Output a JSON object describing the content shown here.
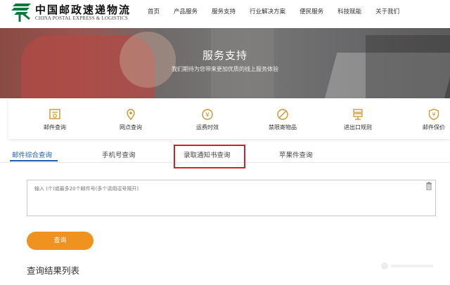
{
  "header": {
    "brand_cn": "中国邮政速递物流",
    "brand_en": "CHINA POSTAL EXPRESS & LOGISTICS",
    "nav": [
      "首页",
      "产品服务",
      "服务支持",
      "行业解决方案",
      "便民服务",
      "科技赋能",
      "关于我们"
    ]
  },
  "banner": {
    "title": "服务支持",
    "subtitle": "我们期待为您带来更加优质的线上服务体验"
  },
  "services": [
    {
      "label": "邮件查询",
      "icon": "mail-search-icon"
    },
    {
      "label": "网点查询",
      "icon": "location-pin-icon"
    },
    {
      "label": "运费时效",
      "icon": "yuan-clock-icon"
    },
    {
      "label": "禁限寄物品",
      "icon": "prohibited-icon"
    },
    {
      "label": "进出口规则",
      "icon": "customs-rules-icon"
    },
    {
      "label": "邮件保价",
      "icon": "shield-yuan-icon"
    }
  ],
  "tabs": [
    "邮件综合查询",
    "手机号查询",
    "录取通知书查询",
    "苹果件查询"
  ],
  "query": {
    "placeholder": "输入 (个)或最多20个邮件号(多个请用逗号隔开)",
    "button": "查询"
  },
  "results_title": "查询结果列表",
  "colors": {
    "accent_blue": "#1f5fb0",
    "brand_green": "#0a7a3b",
    "button_orange": "#f0921f",
    "highlight_red": "#d42020",
    "icon_gold": "#c9962a"
  }
}
